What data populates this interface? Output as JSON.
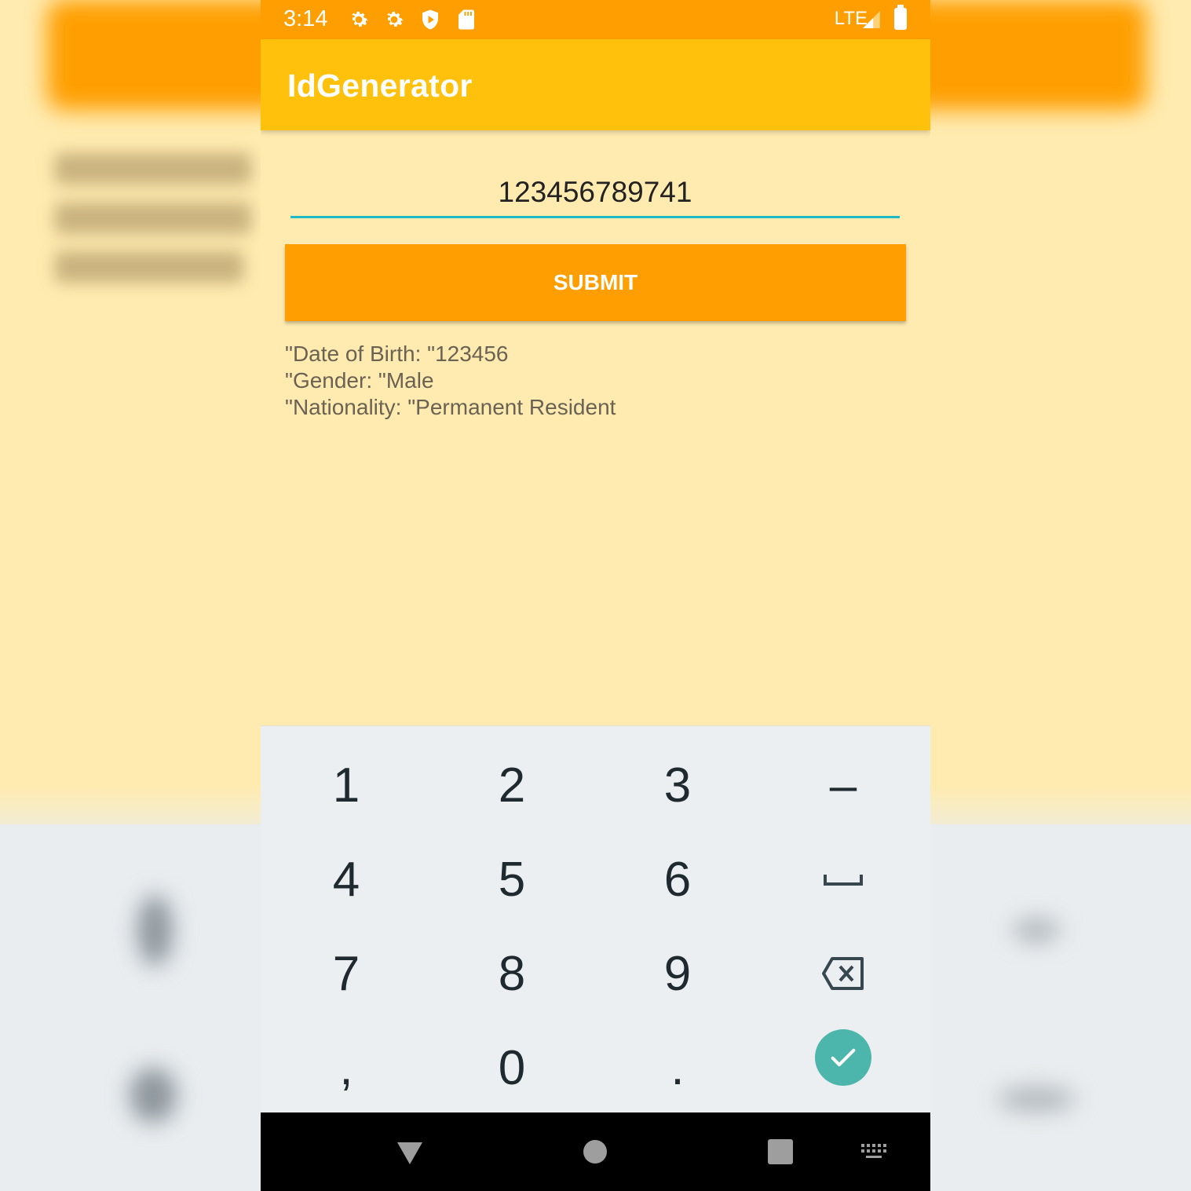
{
  "status_bar": {
    "time": "3:14",
    "network": "LTE",
    "icons": [
      "settings-icon",
      "settings-icon",
      "shield-play-icon",
      "sd-card-icon",
      "signal-icon",
      "battery-icon"
    ]
  },
  "app": {
    "title": "IdGenerator"
  },
  "form": {
    "id_value": "123456789741",
    "submit_label": "SUBMIT"
  },
  "results": {
    "date_of_birth": "\"Date of Birth: \"123456",
    "gender": "\"Gender: \"Male",
    "nationality": "\"Nationality: \"Permanent Resident"
  },
  "keyboard": {
    "row1": [
      "1",
      "2",
      "3",
      "–"
    ],
    "row2": [
      "4",
      "5",
      "6"
    ],
    "row3": [
      "7",
      "8",
      "9"
    ],
    "row4": [
      ",",
      "0",
      "."
    ],
    "icons": [
      "space-icon",
      "backspace-icon",
      "done-check-icon"
    ]
  },
  "nav_bar": {
    "icons": [
      "back-icon",
      "home-icon",
      "recents-icon",
      "keyboard-switch-icon"
    ]
  },
  "colors": {
    "status_bar": "#ff9e00",
    "app_bar": "#ffc10b",
    "background": "#ffebb0",
    "accent": "#1fb9c6",
    "submit": "#ff9e00",
    "keyboard": "#eceff1",
    "done_key": "#4db6ac"
  }
}
